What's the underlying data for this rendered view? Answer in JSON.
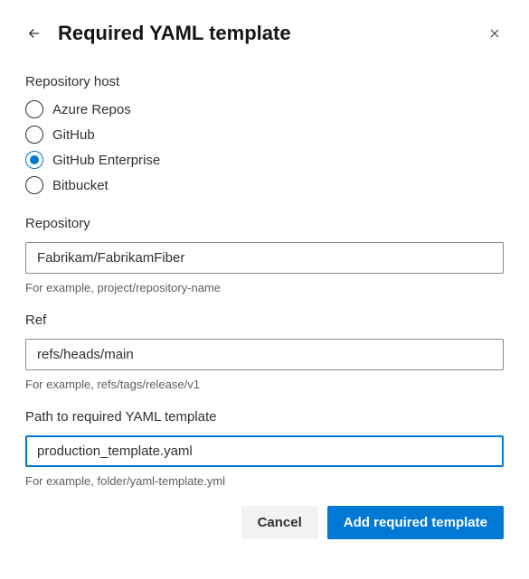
{
  "header": {
    "title": "Required YAML template"
  },
  "host": {
    "label": "Repository host",
    "options": [
      {
        "label": "Azure Repos",
        "selected": false
      },
      {
        "label": "GitHub",
        "selected": false
      },
      {
        "label": "GitHub Enterprise",
        "selected": true
      },
      {
        "label": "Bitbucket",
        "selected": false
      }
    ]
  },
  "repository": {
    "label": "Repository",
    "value": "Fabrikam/FabrikamFiber",
    "helper": "For example, project/repository-name"
  },
  "ref": {
    "label": "Ref",
    "value": "refs/heads/main",
    "helper": "For example, refs/tags/release/v1"
  },
  "path": {
    "label": "Path to required YAML template",
    "value": "production_template.yaml",
    "helper": "For example, folder/yaml-template.yml"
  },
  "buttons": {
    "cancel": "Cancel",
    "submit": "Add required template"
  }
}
